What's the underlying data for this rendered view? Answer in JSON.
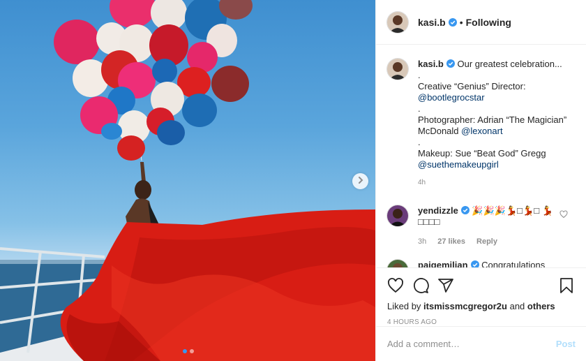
{
  "post_image": {
    "dots_total": 2,
    "dot_active_index": 0,
    "next_icon": "chevron-right-icon"
  },
  "header": {
    "username": "kasi.b",
    "verified": true,
    "separator": "•",
    "follow_status": "Following"
  },
  "caption": {
    "username": "kasi.b",
    "lines": [
      {
        "text": "Our greatest celebration..."
      },
      {
        "text": "."
      },
      {
        "text": "Creative “Genius” Director:"
      },
      {
        "link": "@bootlegrocstar"
      },
      {
        "text": "."
      },
      {
        "text": "Photographer: Adrian “The Magician” McDonald ",
        "link": "@lexonart"
      },
      {
        "text": "."
      },
      {
        "text": "Makeup: Sue “Beat God” Gregg"
      },
      {
        "link": "@suethemakeupgirl"
      }
    ],
    "time": "4h"
  },
  "comments": [
    {
      "username": "yendizzle",
      "verified": true,
      "text": "🎉🎉🎉💃□💃□ 💃□□□□",
      "time": "3h",
      "likes": "27 likes",
      "reply": "Reply"
    },
    {
      "username": "paigemilian",
      "verified": true,
      "text": "Congratulations"
    }
  ],
  "actions": {
    "icons": [
      "heart-icon",
      "comment-icon",
      "share-icon",
      "bookmark-icon"
    ],
    "liked_by_prefix": "Liked by ",
    "liked_by_user": "itsmissmcgregor2u",
    "liked_by_suffix": " and ",
    "liked_by_others": "others",
    "time_ago": "4 HOURS AGO"
  },
  "add_comment": {
    "placeholder": "Add a comment…",
    "post_label": "Post"
  },
  "colors": {
    "link": "#003569",
    "accent": "#3897f0",
    "verified": "#3897f0",
    "post_disabled": "#b2dffc"
  }
}
